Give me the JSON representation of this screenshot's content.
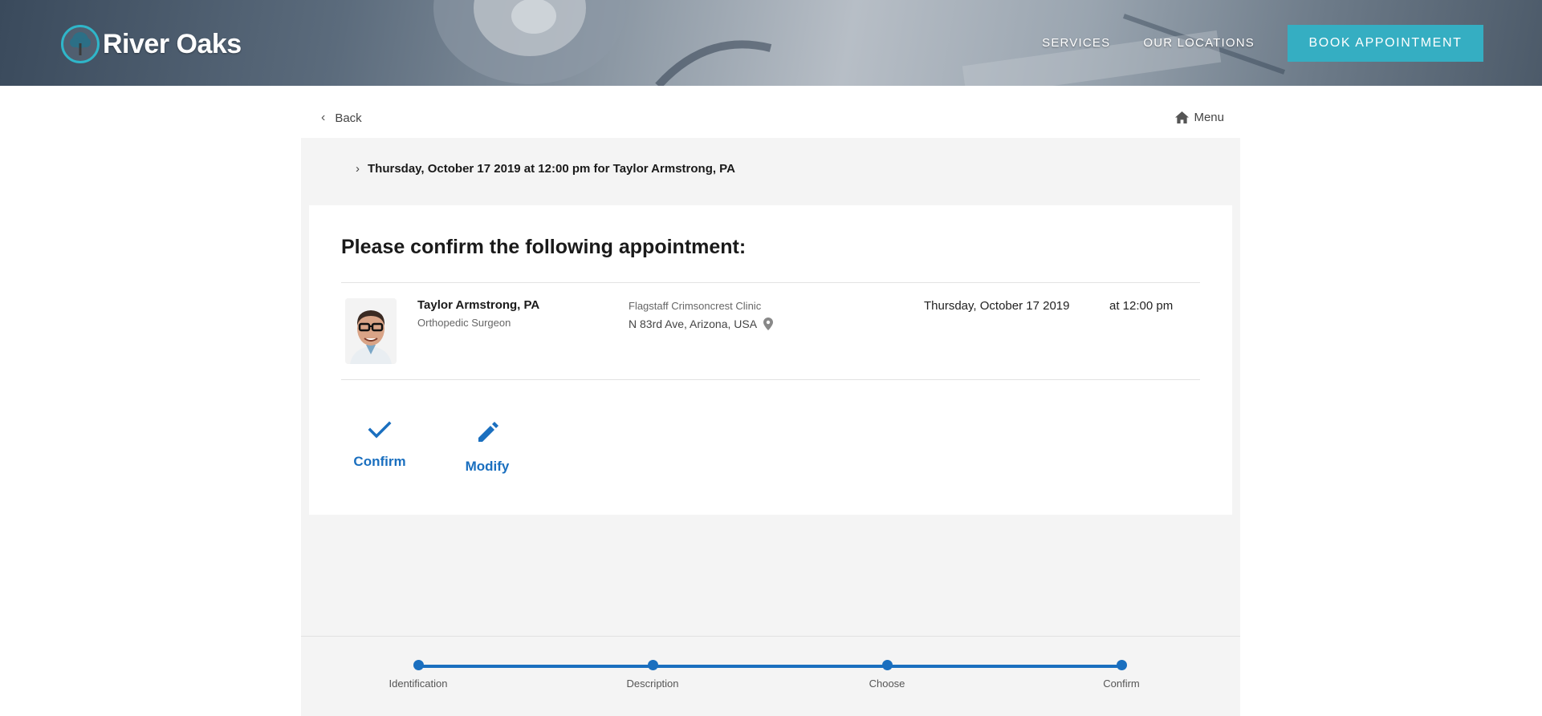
{
  "header": {
    "brand": "River Oaks",
    "nav": [
      "SERVICES",
      "OUR LOCATIONS"
    ],
    "book_label": "BOOK APPOINTMENT"
  },
  "topbar": {
    "back_label": "Back",
    "menu_label": "Menu"
  },
  "summary": "Thursday, October 17 2019 at 12:00 pm for Taylor Armstrong, PA",
  "confirm_card": {
    "title": "Please confirm the following appointment:",
    "provider_name": "Taylor Armstrong, PA",
    "provider_specialty": "Orthopedic Surgeon",
    "clinic": "Flagstaff Crimsoncrest Clinic",
    "address": "N 83rd Ave, Arizona, USA",
    "date": "Thursday, October 17 2019",
    "time": "at 12:00 pm",
    "actions": {
      "confirm": "Confirm",
      "modify": "Modify"
    }
  },
  "progress": {
    "steps": [
      "Identification",
      "Description",
      "Choose",
      "Confirm"
    ],
    "completed": 4
  },
  "colors": {
    "accent": "#1a6fbf",
    "brand_teal": "#35aec2",
    "panel": "#f4f4f4"
  }
}
